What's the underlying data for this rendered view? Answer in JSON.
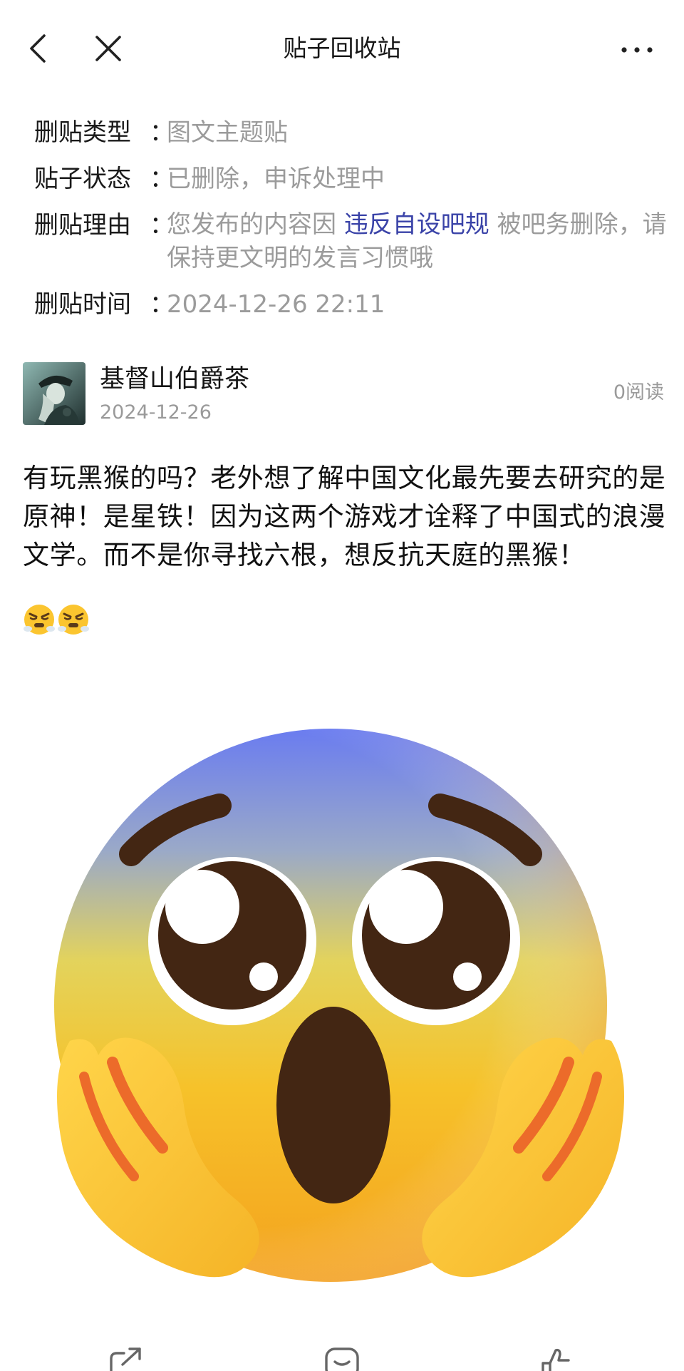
{
  "header": {
    "title": "贴子回收站",
    "back_icon": "chevron-left-icon",
    "close_icon": "close-icon",
    "more_icon": "more-horizontal-icon"
  },
  "info": {
    "type": {
      "label": "删贴类型",
      "colon": "：",
      "value": "图文主题贴"
    },
    "status": {
      "label": "贴子状态",
      "colon": "：",
      "value": "已删除，申诉处理中"
    },
    "reason": {
      "label": "删贴理由",
      "colon": "：",
      "value_pre": "您发布的内容因",
      "value_link": "违反自设吧规",
      "value_post": "被吧务删除，请保持更文明的发言习惯哦"
    },
    "time": {
      "label": "删贴时间",
      "colon": "：",
      "value": "2024-12-26 22:11"
    }
  },
  "post": {
    "author_name": "基督山伯爵茶",
    "date": "2024-12-26",
    "read_count": "0阅读",
    "body": "有玩黑猴的吗？老外想了解中国文化最先要去研究的是原神！是星铁！因为这两个游戏才诠释了中国式的浪漫文学。而不是你寻找六根，想反抗天庭的黑猴！",
    "inline_emojis": [
      "huffing-face-emoji",
      "huffing-face-emoji"
    ],
    "image": "pleading-shocked-face-emoji"
  },
  "bottom_bar": {
    "icons": [
      "share-icon",
      "comment-icon",
      "like-icon"
    ]
  },
  "colors": {
    "link": "#3a43a8",
    "muted": "#9b9b9b",
    "text": "#111111",
    "emoji_top": "#6a7cf0",
    "emoji_yellow": "#f6c22a",
    "emoji_orange": "#f08a1c"
  }
}
